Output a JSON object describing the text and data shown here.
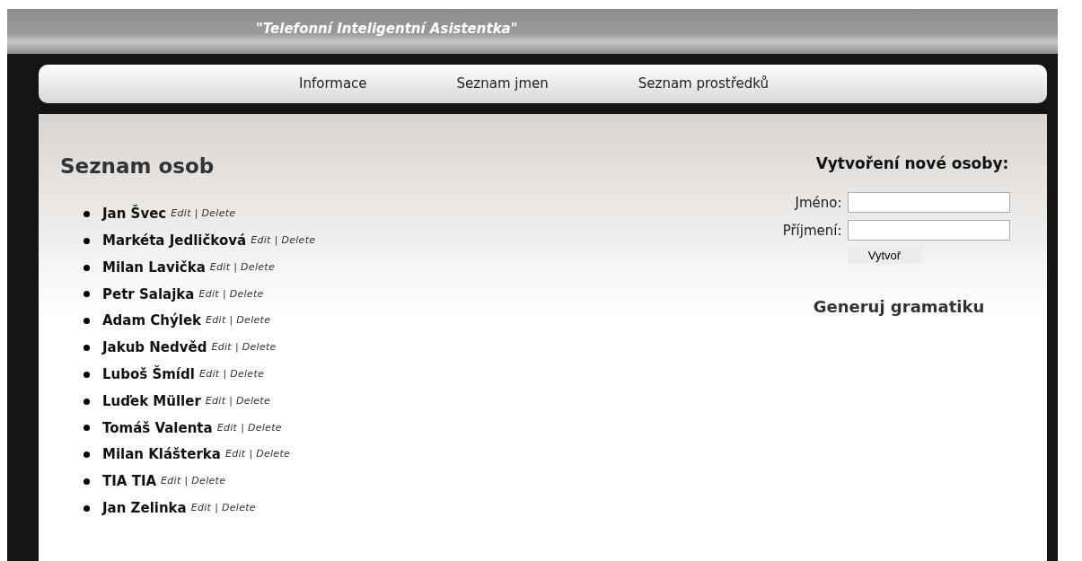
{
  "header": {
    "title": "\"Telefonní Inteligentní Asistentka\""
  },
  "nav": [
    {
      "label": "Informace"
    },
    {
      "label": "Seznam jmen"
    },
    {
      "label": "Seznam prostředků"
    }
  ],
  "people": {
    "heading": "Seznam osob",
    "items": [
      {
        "name": "Jan Švec",
        "edit": "Edit",
        "separator": "|",
        "delete": "Delete"
      },
      {
        "name": "Markéta Jedličková",
        "edit": "Edit",
        "separator": "|",
        "delete": "Delete"
      },
      {
        "name": "Milan Lavička",
        "edit": "Edit",
        "separator": "|",
        "delete": "Delete"
      },
      {
        "name": "Petr Salajka",
        "edit": "Edit",
        "separator": "|",
        "delete": "Delete"
      },
      {
        "name": "Adam Chýlek",
        "edit": "Edit",
        "separator": "|",
        "delete": "Delete"
      },
      {
        "name": "Jakub Nedvěd",
        "edit": "Edit",
        "separator": "|",
        "delete": "Delete"
      },
      {
        "name": "Luboš Šmídl",
        "edit": "Edit",
        "separator": "|",
        "delete": "Delete"
      },
      {
        "name": "Luďek Müller",
        "edit": "Edit",
        "separator": "|",
        "delete": "Delete"
      },
      {
        "name": "Tomáš Valenta",
        "edit": "Edit",
        "separator": "|",
        "delete": "Delete"
      },
      {
        "name": "Milan Klášterka",
        "edit": "Edit",
        "separator": "|",
        "delete": "Delete"
      },
      {
        "name": "TIA TIA",
        "edit": "Edit",
        "separator": "|",
        "delete": "Delete"
      },
      {
        "name": "Jan Zelinka",
        "edit": "Edit",
        "separator": "|",
        "delete": "Delete"
      }
    ]
  },
  "form": {
    "heading": "Vytvoření nové osoby:",
    "fields": [
      {
        "label": "Jméno:"
      },
      {
        "label": "Příjmení:"
      }
    ],
    "submit": "Vytvoř"
  },
  "generate_link": "Generuj gramatiku"
}
